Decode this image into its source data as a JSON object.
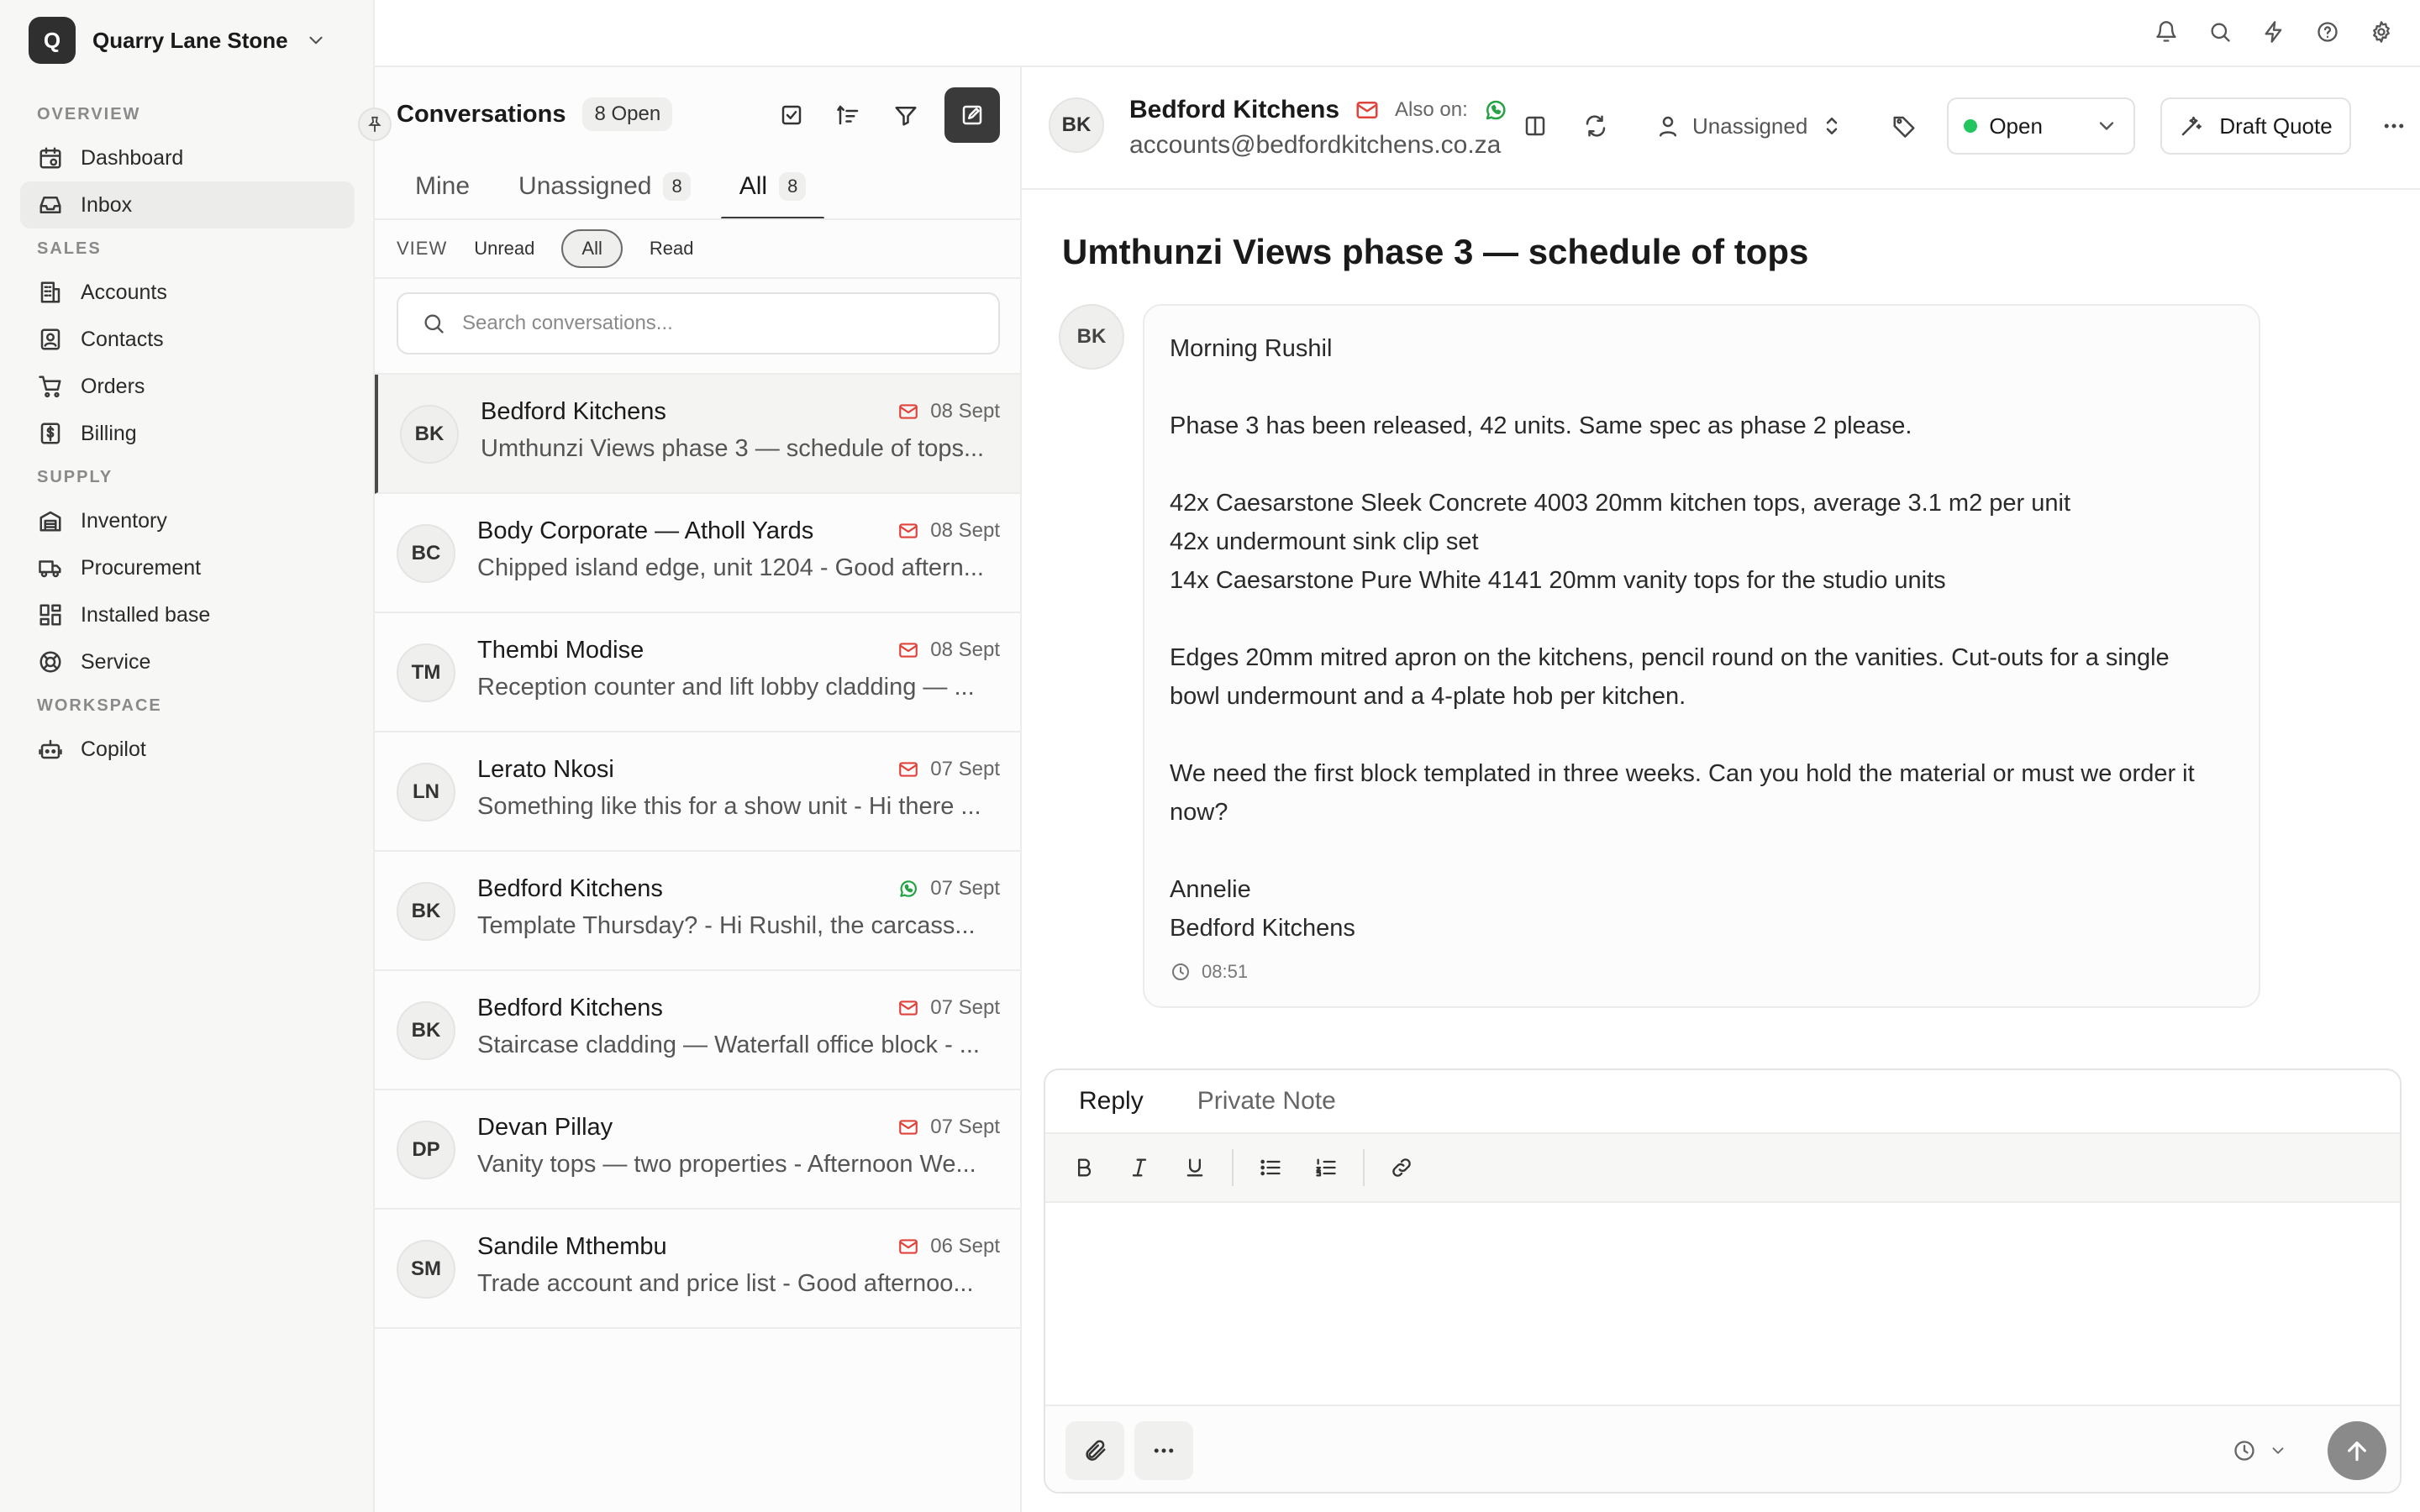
{
  "org": {
    "initial": "Q",
    "name": "Quarry Lane Stone"
  },
  "nav": {
    "sections": {
      "overview": "OVERVIEW",
      "sales": "SALES",
      "supply": "SUPPLY",
      "workspace": "WORKSPACE"
    },
    "items": {
      "dashboard": "Dashboard",
      "inbox": "Inbox",
      "accounts": "Accounts",
      "contacts": "Contacts",
      "orders": "Orders",
      "billing": "Billing",
      "inventory": "Inventory",
      "procurement": "Procurement",
      "installed_base": "Installed base",
      "service": "Service",
      "copilot": "Copilot"
    },
    "active": "inbox"
  },
  "topbar": {
    "icons": [
      "bell-icon",
      "search-icon",
      "bolt-icon",
      "help-icon",
      "gear-icon"
    ]
  },
  "conversations": {
    "title": "Conversations",
    "open_badge": "8 Open",
    "tabs": {
      "mine": {
        "label": "Mine"
      },
      "unassigned": {
        "label": "Unassigned",
        "count": "8"
      },
      "all": {
        "label": "All",
        "count": "8"
      }
    },
    "view": {
      "label": "VIEW",
      "unread": "Unread",
      "all": "All",
      "read": "Read"
    },
    "search_placeholder": "Search conversations...",
    "items": [
      {
        "initials": "BK",
        "name": "Bedford Kitchens",
        "channel": "email",
        "date": "08 Sept",
        "preview": "Umthunzi Views phase 3 — schedule of tops..."
      },
      {
        "initials": "BC",
        "name": "Body Corporate — Atholl Yards",
        "channel": "email",
        "date": "08 Sept",
        "preview": "Chipped island edge, unit 1204 - Good aftern..."
      },
      {
        "initials": "TM",
        "name": "Thembi Modise",
        "channel": "email",
        "date": "08 Sept",
        "preview": "Reception counter and lift lobby cladding — ..."
      },
      {
        "initials": "LN",
        "name": "Lerato Nkosi",
        "channel": "email",
        "date": "07 Sept",
        "preview": "Something like this for a show unit - Hi there ..."
      },
      {
        "initials": "BK",
        "name": "Bedford Kitchens",
        "channel": "whatsapp",
        "date": "07 Sept",
        "preview": "Template Thursday? - Hi Rushil, the carcass..."
      },
      {
        "initials": "BK",
        "name": "Bedford Kitchens",
        "channel": "email",
        "date": "07 Sept",
        "preview": "Staircase cladding — Waterfall office block - ..."
      },
      {
        "initials": "DP",
        "name": "Devan Pillay",
        "channel": "email",
        "date": "07 Sept",
        "preview": "Vanity tops — two properties - Afternoon We..."
      },
      {
        "initials": "SM",
        "name": "Sandile Mthembu",
        "channel": "email",
        "date": "06 Sept",
        "preview": "Trade account and price list - Good afternoo..."
      }
    ]
  },
  "header": {
    "initials": "BK",
    "name": "Bedford Kitchens",
    "also_on": "Also on:",
    "email": "accounts@bedfordkitchens.co.za",
    "assignee": "Unassigned",
    "status": "Open",
    "status_color": "#22c55e",
    "draft_quote": "Draft Quote"
  },
  "message": {
    "subject": "Umthunzi Views phase 3 — schedule of tops",
    "initials": "BK",
    "lines": [
      "Morning Rushil",
      "",
      "Phase 3 has been released, 42 units. Same spec as phase 2 please.",
      "",
      "42x Caesarstone Sleek Concrete 4003 20mm kitchen tops, average 3.1 m2 per unit",
      "42x undermount sink clip set",
      "14x Caesarstone Pure White 4141 20mm vanity tops for the studio units",
      "",
      "Edges 20mm mitred apron on the kitchens, pencil round on the vanities. Cut-outs for a single",
      "bowl undermount and a 4-plate hob per kitchen.",
      "",
      "We need the first block templated in three weeks. Can you hold the material or must we order it",
      "now?",
      "",
      "Annelie",
      "Bedford Kitchens"
    ],
    "time": "08:51"
  },
  "composer": {
    "tab_reply": "Reply",
    "tab_note": "Private Note"
  },
  "colors": {
    "email": "#e0433b",
    "whatsapp": "#25a244",
    "accent": "#3a3a3a"
  }
}
